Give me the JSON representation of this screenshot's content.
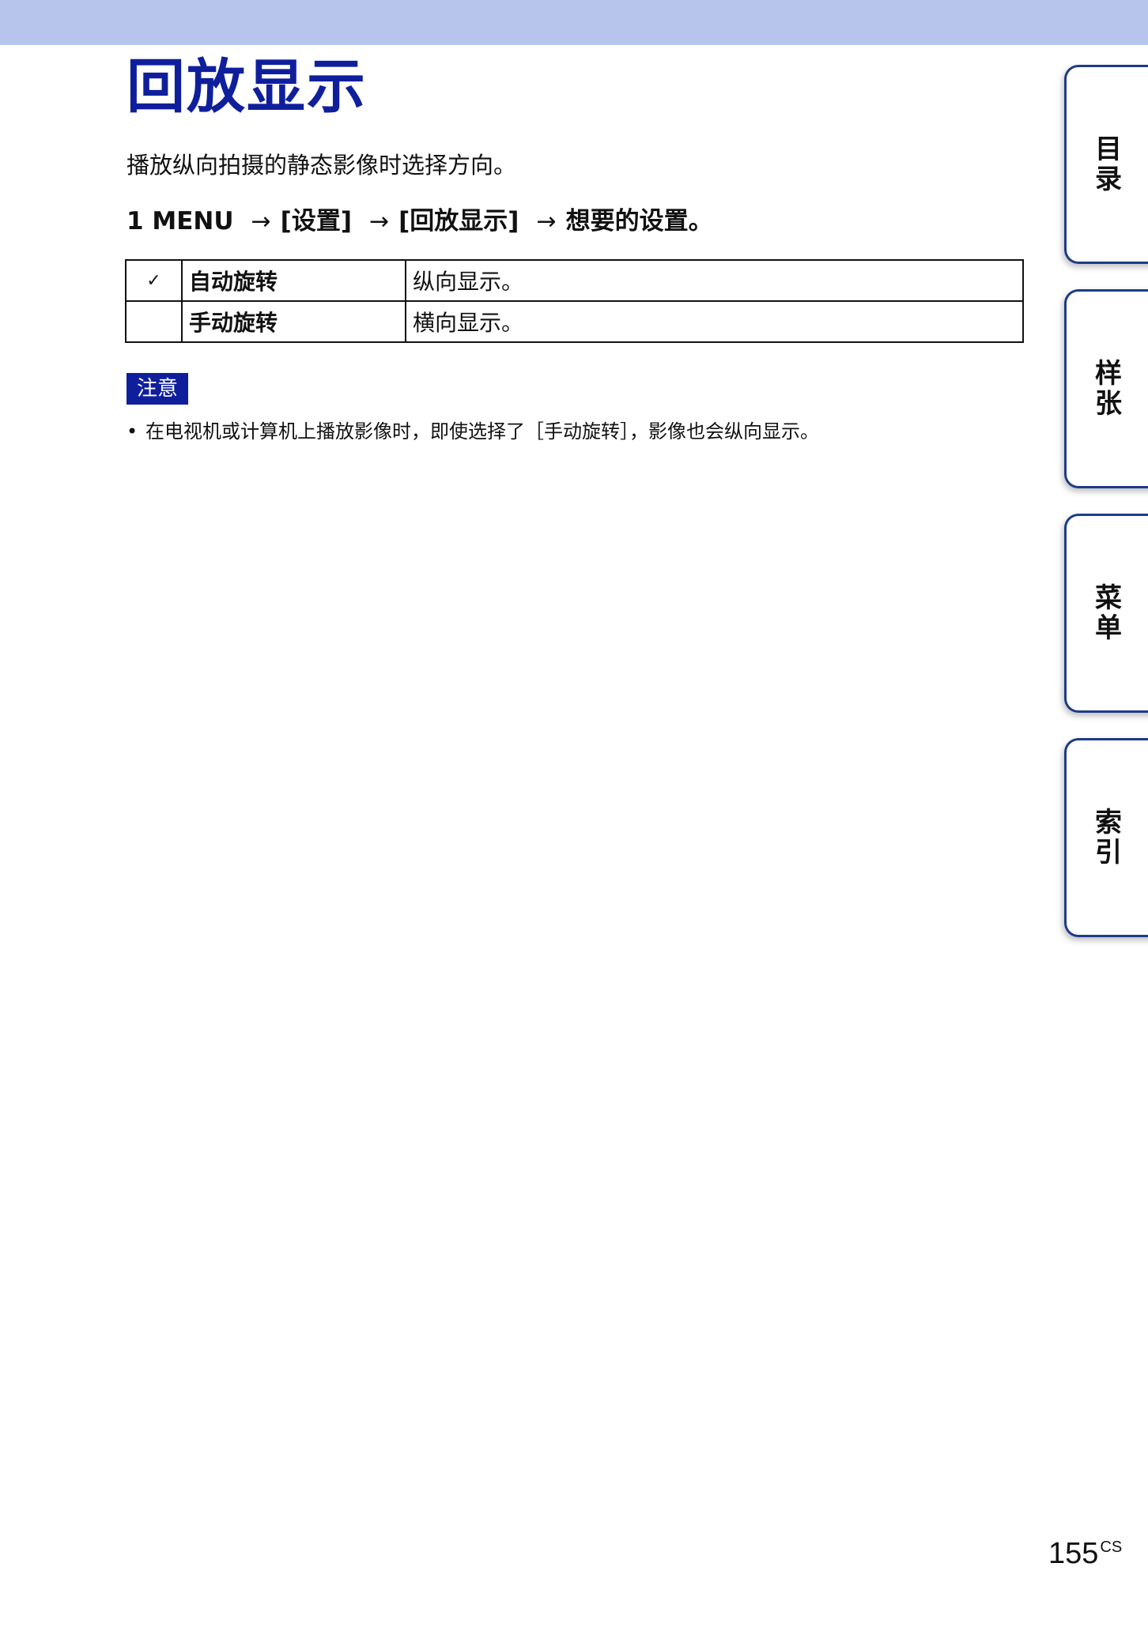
{
  "title": "回放显示",
  "intro": "播放纵向拍摄的静态影像时选择方向。",
  "step": {
    "parts": [
      "1 MENU",
      "[设置]",
      "[回放显示]",
      "想要的设置。"
    ],
    "arrow": "→"
  },
  "options": [
    {
      "check": "✓",
      "name": "自动旋转",
      "desc": "纵向显示。"
    },
    {
      "check": "",
      "name": "手动旋转",
      "desc": "横向显示。"
    }
  ],
  "note": {
    "label": "注意",
    "bullet": "•",
    "text": "在电视机或计算机上播放影像时，即使选择了［手动旋转］，影像也会纵向显示。"
  },
  "tabs": [
    "目录",
    "样张",
    "菜单",
    "索引"
  ],
  "page": {
    "number": "155",
    "suffix": "CS"
  }
}
